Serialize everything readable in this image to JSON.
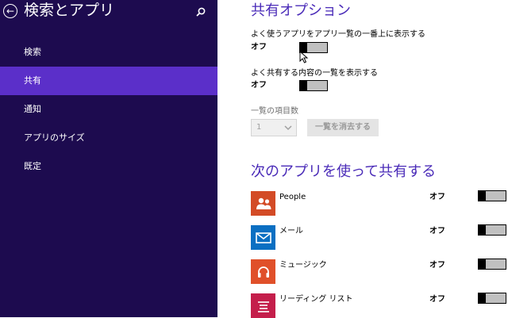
{
  "colors": {
    "sidebar_bg": "#1d0b4f",
    "sidebar_active": "#5b2fc9",
    "accent_title": "#4a2bb8",
    "people_icon": "#d34b26",
    "mail_icon": "#0b6fc2",
    "music_icon": "#e0502a",
    "reading_icon": "#c41e4b"
  },
  "sidebar": {
    "title": "検索とアプリ",
    "items": [
      {
        "label": "検索",
        "active": false
      },
      {
        "label": "共有",
        "active": true
      },
      {
        "label": "通知",
        "active": false
      },
      {
        "label": "アプリのサイズ",
        "active": false
      },
      {
        "label": "既定",
        "active": false
      }
    ]
  },
  "share_options": {
    "title": "共有オプション",
    "frequent_apps": {
      "label": "よく使うアプリをアプリ一覧の一番上に表示する",
      "state": "オフ",
      "on": false
    },
    "frequent_content": {
      "label": "よく共有する内容の一覧を表示する",
      "state": "オフ",
      "on": false
    },
    "list_count": {
      "label": "一覧の項目数",
      "value": "1",
      "clear_label": "一覧を消去する"
    }
  },
  "apps_section": {
    "title": "次のアプリを使って共有する",
    "apps": [
      {
        "name": "People",
        "icon": "people-icon",
        "state": "オフ",
        "on": false
      },
      {
        "name": "メール",
        "icon": "mail-icon",
        "state": "オフ",
        "on": false
      },
      {
        "name": "ミュージック",
        "icon": "headphones-icon",
        "state": "オフ",
        "on": false
      },
      {
        "name": "リーディング リスト",
        "icon": "reading-list-icon",
        "state": "オフ",
        "on": false
      }
    ]
  }
}
